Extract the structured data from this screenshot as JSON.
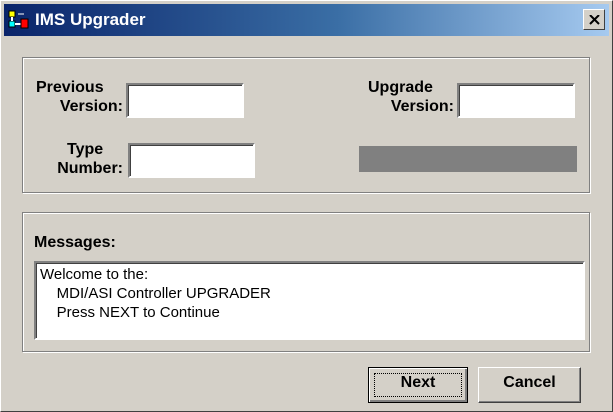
{
  "window": {
    "title": "IMS Upgrader"
  },
  "fields": {
    "previous_version": {
      "label_line1": "Previous",
      "label_line2": "Version:",
      "value": ""
    },
    "upgrade_version": {
      "label_line1": "Upgrade",
      "label_line2": "Version:",
      "value": ""
    },
    "type_number": {
      "label_line1": "Type",
      "label_line2": "Number:",
      "value": ""
    }
  },
  "messages": {
    "label": "Messages:",
    "lines": [
      "Welcome to the:",
      "    MDI/ASI Controller UPGRADER",
      "    Press NEXT to Continue"
    ]
  },
  "buttons": {
    "next": "Next",
    "cancel": "Cancel"
  },
  "colors": {
    "titlebar_start": "#0a246a",
    "titlebar_end": "#a6caf0",
    "face": "#d4d0c8",
    "progress": "#808080"
  },
  "icons": {
    "app": "ims-app-icon",
    "close": "close-icon"
  }
}
